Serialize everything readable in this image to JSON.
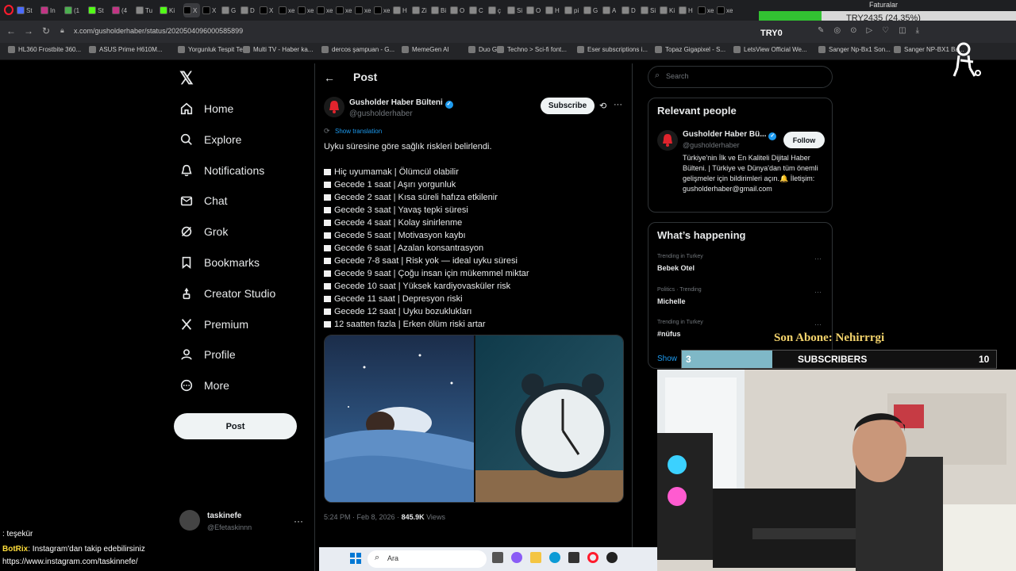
{
  "browser": {
    "tabs": [
      {
        "label": "St",
        "color": "#4b6bff"
      },
      {
        "label": "In",
        "color": "#c13584"
      },
      {
        "label": "(1",
        "color": "#4caf50"
      },
      {
        "label": "St",
        "color": "#53fc18"
      },
      {
        "label": "(4",
        "color": "#c13584"
      },
      {
        "label": "Tu",
        "color": "#888888"
      },
      {
        "label": "Ki",
        "color": "#53fc18"
      },
      {
        "label": "X",
        "color": "#000000"
      },
      {
        "label": "X",
        "color": "#000000"
      },
      {
        "label": "G",
        "color": "#888888"
      },
      {
        "label": "D",
        "color": "#888888"
      },
      {
        "label": "X",
        "color": "#000000"
      },
      {
        "label": "xe",
        "color": "#000000"
      },
      {
        "label": "xe",
        "color": "#000000"
      },
      {
        "label": "xe",
        "color": "#000000"
      },
      {
        "label": "xe",
        "color": "#000000"
      },
      {
        "label": "xe",
        "color": "#000000"
      },
      {
        "label": "xe",
        "color": "#000000"
      },
      {
        "label": "H",
        "color": "#888888"
      },
      {
        "label": "Zi",
        "color": "#888888"
      },
      {
        "label": "Bi",
        "color": "#888888"
      },
      {
        "label": "O",
        "color": "#888888"
      },
      {
        "label": "C",
        "color": "#888888"
      },
      {
        "label": "ç",
        "color": "#888888"
      },
      {
        "label": "Si",
        "color": "#888888"
      },
      {
        "label": "O",
        "color": "#888888"
      },
      {
        "label": "H",
        "color": "#888888"
      },
      {
        "label": "pi",
        "color": "#888888"
      },
      {
        "label": "G",
        "color": "#888888"
      },
      {
        "label": "A",
        "color": "#888888"
      },
      {
        "label": "D",
        "color": "#888888"
      },
      {
        "label": "Si",
        "color": "#888888"
      },
      {
        "label": "Ki",
        "color": "#888888"
      },
      {
        "label": "H",
        "color": "#888888"
      },
      {
        "label": "xe",
        "color": "#000000"
      },
      {
        "label": "xe",
        "color": "#000000"
      }
    ],
    "url": "x.com/gusholderhaber/status/2020504096000585899",
    "bookmarks": [
      "HL360 Frostbite 360...",
      "ASUS Prime H610M...",
      "Yorgunluk Tespit Test",
      "Multi TV - Haber ka...",
      "dercos şampuan - G...",
      "MemeGen AI",
      "Duo Go",
      "Techno > Sci-fi font...",
      "Eser subscriptions i...",
      "Topaz Gigapixel - S...",
      "LetsView Official We...",
      "Sanger Np-Bx1 Son...",
      "Sanger NP-BX1 Ba..."
    ]
  },
  "overlay": {
    "faturalar": "Faturalar",
    "progress_text": "TRY2435 (24.35%)",
    "progress_fraction": 0.2435,
    "try_label": "TRY0",
    "son_abone": "Son Abone: Nehirrrgi",
    "sub_current": "3",
    "sub_label": "SUBSCRIBERS",
    "sub_goal": "10",
    "sub_fraction": 0.3,
    "chat": [
      {
        "user": "",
        "text": ": teşekür"
      },
      {
        "user": "BotRix",
        "text": ": Instagram'dan takip edebilirsiniz"
      },
      {
        "user": "",
        "text": "https://www.instagram.com/taskinnefe/"
      }
    ],
    "taskbar_search": "Ara"
  },
  "nav": {
    "items": [
      {
        "label": "Home",
        "icon": "home-icon"
      },
      {
        "label": "Explore",
        "icon": "search-icon"
      },
      {
        "label": "Notifications",
        "icon": "bell-icon"
      },
      {
        "label": "Chat",
        "icon": "mail-icon"
      },
      {
        "label": "Grok",
        "icon": "grok-icon"
      },
      {
        "label": "Bookmarks",
        "icon": "bookmark-icon"
      },
      {
        "label": "Creator Studio",
        "icon": "creator-icon"
      },
      {
        "label": "Premium",
        "icon": "x-icon"
      },
      {
        "label": "Profile",
        "icon": "person-icon"
      },
      {
        "label": "More",
        "icon": "more-icon"
      }
    ],
    "post_button": "Post",
    "account": {
      "name": "taskinefe",
      "handle": "@Efetaskinnn"
    }
  },
  "post": {
    "header": "Post",
    "author_name": "Gusholder Haber Bülteni",
    "author_handle": "@gusholderhaber",
    "subscribe": "Subscribe",
    "show_translation": "Show translation",
    "intro": "Uyku süresine göre sağlık riskleri belirlendi.",
    "lines": [
      "Hiç uyumamak | Ölümcül olabilir",
      "Gecede 1 saat | Aşırı yorgunluk",
      "Gecede 2 saat | Kısa süreli hafıza etkilenir",
      "Gecede 3 saat | Yavaş tepki süresi",
      "Gecede 4 saat | Kolay sinirlenme",
      "Gecede 5 saat | Motivasyon kaybı",
      "Gecede 6 saat | Azalan konsantrasyon",
      "Gecede 7-8 saat | Risk yok — ideal uyku süresi",
      "Gecede 9 saat | Çoğu insan için mükemmel miktar",
      "Gecede 10 saat | Yüksek kardiyovasküler risk",
      "Gecede 11 saat | Depresyon riski",
      "Gecede 12 saat | Uyku bozuklukları",
      "12 saatten fazla | Erken ölüm riski artar"
    ],
    "time": "5:24 PM · Feb 8, 2026 · ",
    "views_count": "845.9K",
    "views_label": " Views"
  },
  "sidebar": {
    "search_placeholder": "Search",
    "relevant_title": "Relevant people",
    "person": {
      "name": "Gusholder Haber Bü...",
      "handle": "@gusholderhaber",
      "follow": "Follow",
      "bio": "Türkiye'nin İlk ve En Kaliteli Dijital Haber Bülteni. | Türkiye ve Dünya'dan tüm önemli gelişmeler için bildirimleri açın.🔔 İletişim: gusholderhaber@gmail.com"
    },
    "happening_title": "What’s happening",
    "trends": [
      {
        "category": "Trending in Turkey",
        "name": "Bebek Otel"
      },
      {
        "category": "Politics · Trending",
        "name": "Michelle"
      },
      {
        "category": "Trending in Turkey",
        "name": "#nüfus"
      }
    ],
    "show_more": "Show"
  },
  "colors": {
    "accent": "#1d9bf0",
    "progress": "#32c232",
    "sub_fill": "#7fb8c7"
  }
}
